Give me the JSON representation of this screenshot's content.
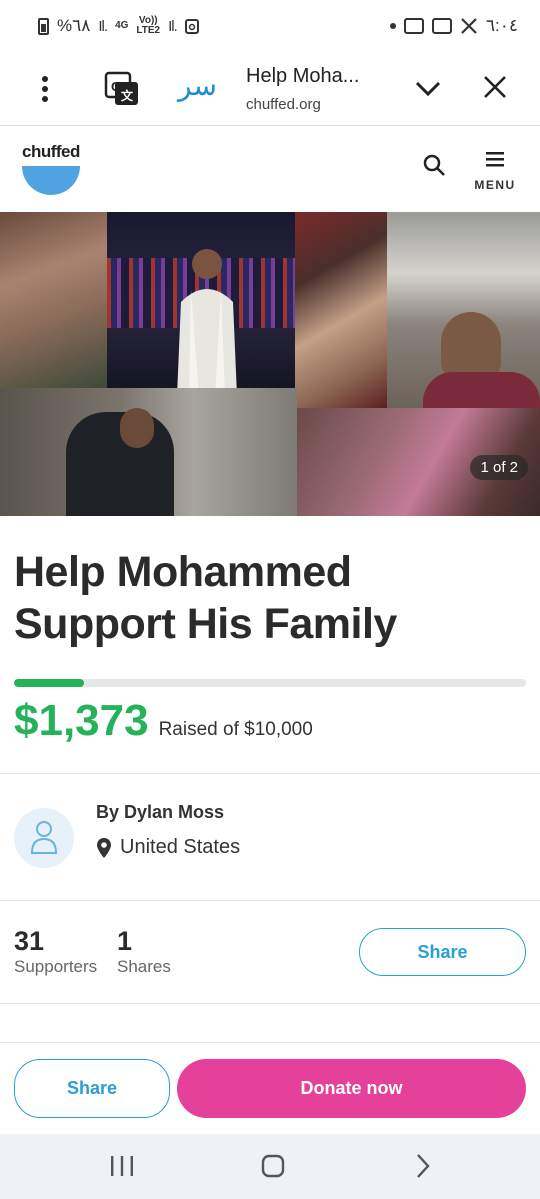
{
  "status_bar": {
    "left_text": "%٦٨",
    "network_top": "4G",
    "network_bottom": "LTE2",
    "volte": "Vo))",
    "time": "٦:٠٤"
  },
  "browser": {
    "page_title": "Help Moha...",
    "domain": "chuffed.org",
    "site_glyph": "ﺳﺮ"
  },
  "site_header": {
    "logo_text": "chuffed",
    "menu_label": "MENU"
  },
  "hero": {
    "pager_text": "1 of 2"
  },
  "campaign": {
    "title": "Help Mohammed Support His Family",
    "raised_amount": "$1,373",
    "raised_label": "Raised of $10,000",
    "progress_fraction": 0.137
  },
  "organiser": {
    "name": "By Dylan Moss",
    "location": "United States"
  },
  "stats": {
    "supporters_count": "31",
    "supporters_label": "Supporters",
    "shares_count": "1",
    "shares_label": "Shares",
    "share_button": "Share"
  },
  "action_bar": {
    "share_button": "Share",
    "donate_button": "Donate now"
  },
  "colors": {
    "green": "#25b25a",
    "pink": "#e5409a",
    "blue": "#2a9fd6",
    "logo_blue": "#4fa3e0"
  }
}
